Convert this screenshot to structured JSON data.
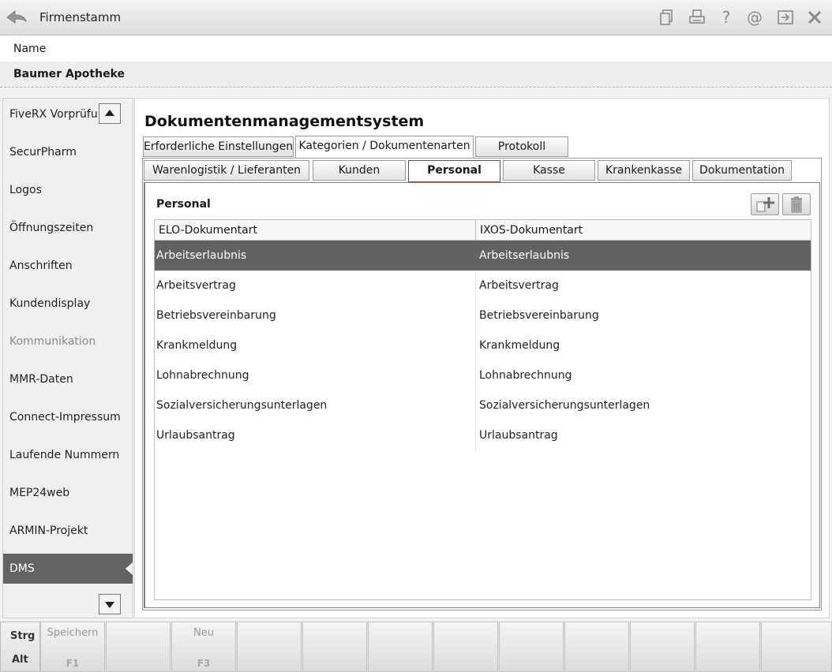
{
  "titlebar": {
    "title": "Firmenstamm",
    "icons": [
      "back-arrow-icon",
      "copy-document-icon",
      "print-icon",
      "help-icon",
      "at-email-icon",
      "export-window-icon",
      "close-icon"
    ]
  },
  "header": {
    "name_label": "Name",
    "name_value": "Baumer Apotheke"
  },
  "sidebar": {
    "items": [
      {
        "label": "FiveRX Vorprüfung",
        "state": "normal"
      },
      {
        "label": "SecurPharm",
        "state": "normal"
      },
      {
        "label": "Logos",
        "state": "normal"
      },
      {
        "label": "Öffnungszeiten",
        "state": "normal"
      },
      {
        "label": "Anschriften",
        "state": "normal"
      },
      {
        "label": "Kundendisplay",
        "state": "normal"
      },
      {
        "label": "Kommunikation",
        "state": "disabled"
      },
      {
        "label": "MMR-Daten",
        "state": "normal"
      },
      {
        "label": "Connect-Impressum",
        "state": "normal"
      },
      {
        "label": "Laufende Nummern",
        "state": "normal"
      },
      {
        "label": "MEP24web",
        "state": "normal"
      },
      {
        "label": "ARMIN-Projekt",
        "state": "normal"
      },
      {
        "label": "DMS",
        "state": "active"
      }
    ]
  },
  "main": {
    "title": "Dokumentenmanagementsystem",
    "tabs": [
      {
        "label": "Erforderliche Einstellungen",
        "selected": false
      },
      {
        "label": "Kategorien / Dokumentenarten",
        "selected": true
      },
      {
        "label": "Protokoll",
        "selected": false
      }
    ],
    "subtabs": [
      {
        "label": "Warenlogistik / Lieferanten",
        "selected": false
      },
      {
        "label": "Kunden",
        "selected": false
      },
      {
        "label": "Personal",
        "selected": true
      },
      {
        "label": "Kasse",
        "selected": false
      },
      {
        "label": "Krankenkasse",
        "selected": false
      },
      {
        "label": "Dokumentation",
        "selected": false
      }
    ],
    "section_title": "Personal",
    "grid": {
      "columns": [
        "ELO-Dokumentart",
        "IXOS-Dokumentart"
      ],
      "rows": [
        {
          "elo": "Arbeitserlaubnis",
          "ixos": "Arbeitserlaubnis",
          "selected": true
        },
        {
          "elo": "Arbeitsvertrag",
          "ixos": "Arbeitsvertrag",
          "selected": false
        },
        {
          "elo": "Betriebsvereinbarung",
          "ixos": "Betriebsvereinbarung",
          "selected": false
        },
        {
          "elo": "Krankmeldung",
          "ixos": "Krankmeldung",
          "selected": false
        },
        {
          "elo": "Lohnabrechnung",
          "ixos": "Lohnabrechnung",
          "selected": false
        },
        {
          "elo": "Sozialversicherungsunterlagen",
          "ixos": "Sozialversicherungsunterlagen",
          "selected": false
        },
        {
          "elo": "Urlaubsantrag",
          "ixos": "Urlaubsantrag",
          "selected": false
        }
      ]
    }
  },
  "fkeys": {
    "modifiers": [
      "Strg",
      "Alt"
    ],
    "keys": [
      {
        "label": "Speichern",
        "key": "F1"
      },
      {
        "label": "",
        "key": ""
      },
      {
        "label": "Neu",
        "key": "F3"
      },
      {
        "label": "",
        "key": ""
      },
      {
        "label": "",
        "key": ""
      },
      {
        "label": "",
        "key": ""
      },
      {
        "label": "",
        "key": ""
      },
      {
        "label": "",
        "key": ""
      },
      {
        "label": "",
        "key": ""
      },
      {
        "label": "",
        "key": ""
      },
      {
        "label": "",
        "key": ""
      },
      {
        "label": "",
        "key": ""
      }
    ]
  },
  "colors": {
    "selection": "#626262",
    "active_subtab_border": "#a23a3a"
  }
}
